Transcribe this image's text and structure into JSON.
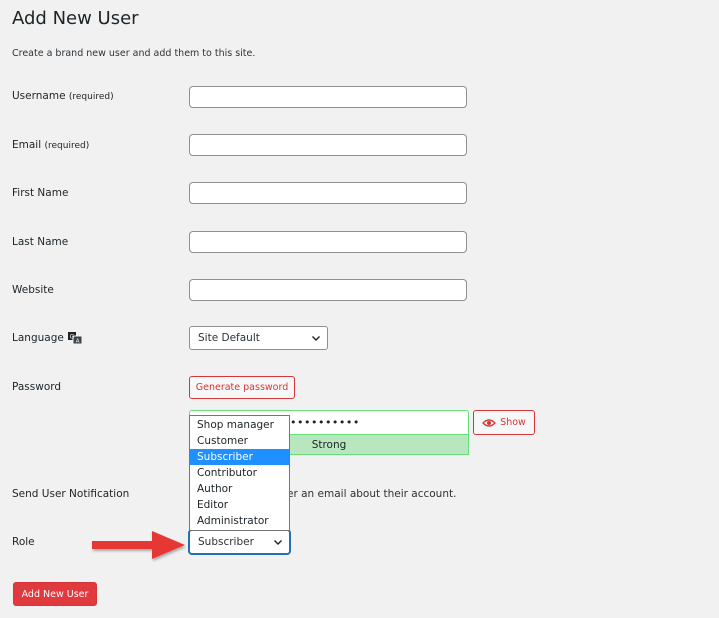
{
  "page": {
    "title": "Add New User",
    "subtitle": "Create a brand new user and add them to this site."
  },
  "fields": {
    "username": {
      "label": "Username",
      "required": "(required)",
      "value": ""
    },
    "email": {
      "label": "Email",
      "required": "(required)",
      "value": ""
    },
    "first_name": {
      "label": "First Name",
      "value": ""
    },
    "last_name": {
      "label": "Last Name",
      "value": ""
    },
    "website": {
      "label": "Website",
      "value": ""
    },
    "language": {
      "label": "Language",
      "selected": "Site Default"
    },
    "password": {
      "label": "Password",
      "generate_label": "Generate password",
      "masked_value": "••••••••••",
      "strength": "Strong",
      "show_label": "Show"
    },
    "notification": {
      "label": "Send User Notification",
      "text": "er an email about their account."
    },
    "role": {
      "label": "Role",
      "selected": "Subscriber",
      "options": [
        "Shop manager",
        "Customer",
        "Subscriber",
        "Contributor",
        "Author",
        "Editor",
        "Administrator"
      ]
    }
  },
  "submit_label": "Add New User",
  "colors": {
    "accent_red": "#d63638",
    "focus_blue": "#2271b1",
    "strength_green": "#b8e6bf",
    "selected_option": "#1e90ff",
    "annotation_arrow": "#e53935"
  }
}
